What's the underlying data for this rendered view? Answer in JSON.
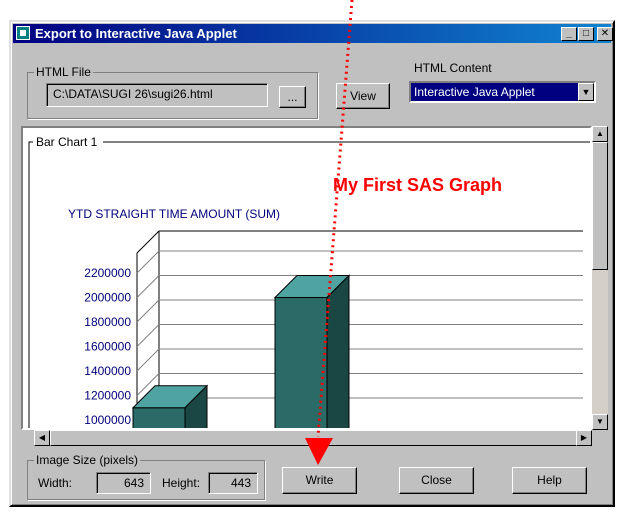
{
  "window": {
    "title": "Export to Interactive Java Applet",
    "buttons": [
      "_",
      "□",
      "✕"
    ]
  },
  "html_file": {
    "group_label": "HTML File",
    "path": "C:\\DATA\\SUGI 26\\sugi26.html",
    "browse_label": "...",
    "view_label": "View"
  },
  "html_content": {
    "label": "HTML Content",
    "selected": "Interactive Java Applet"
  },
  "preview": {
    "group_label": "Bar Chart 1"
  },
  "chart_data": {
    "type": "bar",
    "title": "My First SAS Graph",
    "ylabel": "YTD STRAIGHT TIME AMOUNT (SUM)",
    "yticks": [
      2200000,
      2000000,
      1800000,
      1600000,
      1400000,
      1200000,
      1000000
    ],
    "ylim": [
      1000000,
      2200000
    ],
    "values": [
      1100000,
      2000000
    ],
    "colors": {
      "bar_front": "#2b6b67",
      "bar_top": "#4fa3a0",
      "bar_side": "#1a4744",
      "grid": "#808080"
    }
  },
  "image_size": {
    "group_label": "Image Size (pixels)",
    "width_label": "Width:",
    "width_value": "643",
    "height_label": "Height:",
    "height_value": "443"
  },
  "buttons": {
    "write": "Write",
    "close": "Close",
    "help": "Help"
  },
  "annotation": {
    "color": "#ff0000"
  }
}
